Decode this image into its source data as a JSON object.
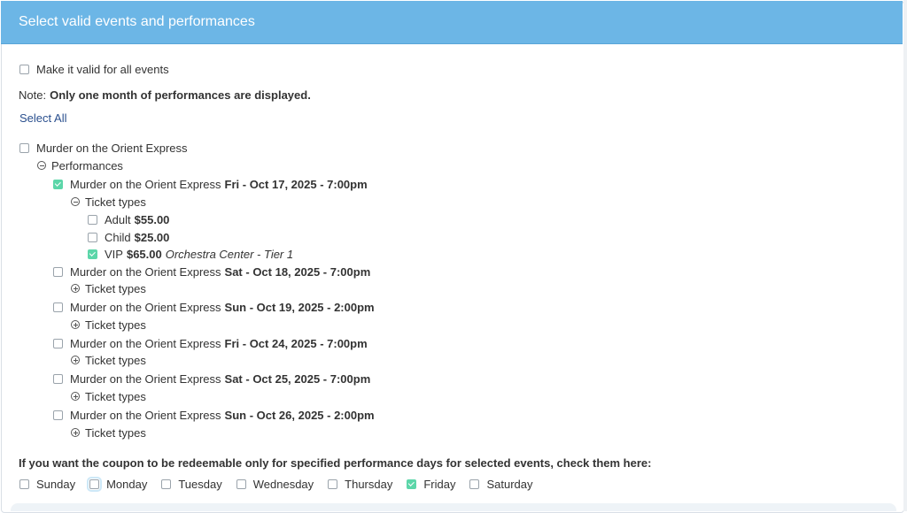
{
  "header": {
    "title": "Select valid events and performances"
  },
  "all_events": {
    "label": "Make it valid for all events",
    "checked": false
  },
  "note": {
    "prefix": "Note:",
    "text": "Only one month of performances are displayed."
  },
  "select_all": "Select All",
  "event": {
    "name": "Murder on the Orient Express",
    "checked": false,
    "performances_label": "Performances",
    "ticket_types_label": "Ticket types",
    "performances": [
      {
        "name": "Murder on the Orient Express",
        "date": "Fri - Oct 17, 2025 - 7:00pm",
        "checked": true,
        "expanded": true,
        "tickets": [
          {
            "name": "Adult",
            "price": "$55.00",
            "section": "",
            "checked": false
          },
          {
            "name": "Child",
            "price": "$25.00",
            "section": "",
            "checked": false
          },
          {
            "name": "VIP",
            "price": "$65.00",
            "section": "Orchestra Center - Tier 1",
            "checked": true
          }
        ]
      },
      {
        "name": "Murder on the Orient Express",
        "date": "Sat - Oct 18, 2025 - 7:00pm",
        "checked": false,
        "expanded": false
      },
      {
        "name": "Murder on the Orient Express",
        "date": "Sun - Oct 19, 2025 - 2:00pm",
        "checked": false,
        "expanded": false
      },
      {
        "name": "Murder on the Orient Express",
        "date": "Fri - Oct 24, 2025 - 7:00pm",
        "checked": false,
        "expanded": false
      },
      {
        "name": "Murder on the Orient Express",
        "date": "Sat - Oct 25, 2025 - 7:00pm",
        "checked": false,
        "expanded": false
      },
      {
        "name": "Murder on the Orient Express",
        "date": "Sun - Oct 26, 2025 - 2:00pm",
        "checked": false,
        "expanded": false
      }
    ]
  },
  "days_prompt": "If you want the coupon to be redeemable only for specified performance days for selected events, check them here:",
  "days": [
    {
      "label": "Sunday",
      "checked": false
    },
    {
      "label": "Monday",
      "checked": false
    },
    {
      "label": "Tuesday",
      "checked": false
    },
    {
      "label": "Wednesday",
      "checked": false
    },
    {
      "label": "Thursday",
      "checked": false
    },
    {
      "label": "Friday",
      "checked": true
    },
    {
      "label": "Saturday",
      "checked": false
    }
  ],
  "colors": {
    "header_bg": "#6cb6e6",
    "check_accent": "#5cd6a9",
    "link": "#2a4f8e"
  }
}
